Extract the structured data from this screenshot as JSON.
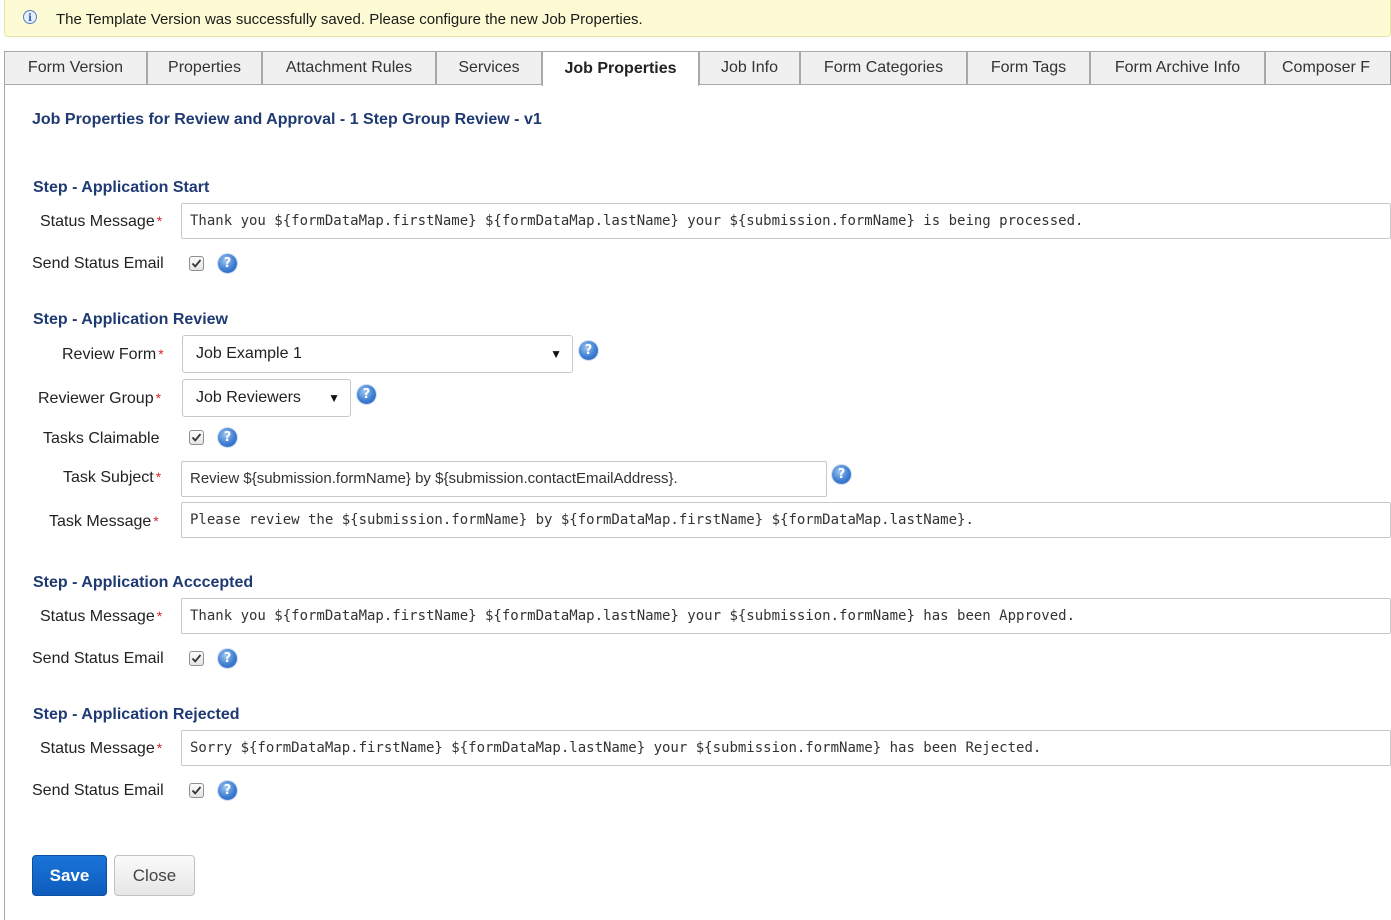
{
  "notice": {
    "message": "The Template Version was successfully saved. Please configure the new Job Properties."
  },
  "tabs": [
    {
      "label": "Form Version"
    },
    {
      "label": "Properties"
    },
    {
      "label": "Attachment Rules"
    },
    {
      "label": "Services"
    },
    {
      "label": "Job Properties",
      "active": true
    },
    {
      "label": "Job Info"
    },
    {
      "label": "Form Categories"
    },
    {
      "label": "Form Tags"
    },
    {
      "label": "Form Archive Info"
    },
    {
      "label": "Composer F"
    }
  ],
  "page_title": "Job Properties for Review and Approval - 1 Step Group Review - v1",
  "steps": {
    "start": {
      "heading": "Step - Application Start",
      "status_message_label": "Status Message",
      "status_message_value": "Thank you ${formDataMap.firstName} ${formDataMap.lastName} your ${submission.formName} is being processed.",
      "send_email_label": "Send Status Email",
      "send_email_checked": true
    },
    "review": {
      "heading": "Step - Application Review",
      "review_form_label": "Review Form",
      "review_form_value": "Job Example 1",
      "reviewer_group_label": "Reviewer Group",
      "reviewer_group_value": "Job Reviewers",
      "tasks_claimable_label": "Tasks Claimable",
      "tasks_claimable_checked": true,
      "task_subject_label": "Task Subject",
      "task_subject_value": "Review ${submission.formName} by ${submission.contactEmailAddress}.",
      "task_message_label": "Task Message",
      "task_message_value": "Please review the ${submission.formName} by ${formDataMap.firstName} ${formDataMap.lastName}."
    },
    "accepted": {
      "heading": "Step - Application Acccepted",
      "status_message_label": "Status Message",
      "status_message_value": "Thank you ${formDataMap.firstName} ${formDataMap.lastName} your ${submission.formName} has been Approved.",
      "send_email_label": "Send Status Email",
      "send_email_checked": true
    },
    "rejected": {
      "heading": "Step - Application Rejected",
      "status_message_label": "Status Message",
      "status_message_value": "Sorry ${formDataMap.firstName} ${formDataMap.lastName} your ${submission.formName} has been Rejected.",
      "send_email_label": "Send Status Email",
      "send_email_checked": true
    }
  },
  "required_marker": "*",
  "help_glyph": "?",
  "dropdown_arrow": "▼",
  "buttons": {
    "save_label": "Save",
    "close_label": "Close"
  },
  "colors": {
    "heading": "#1f3a72",
    "required": "#d9262c",
    "primary_button": "#1467cc",
    "notice_bg": "#fdfbd3"
  }
}
